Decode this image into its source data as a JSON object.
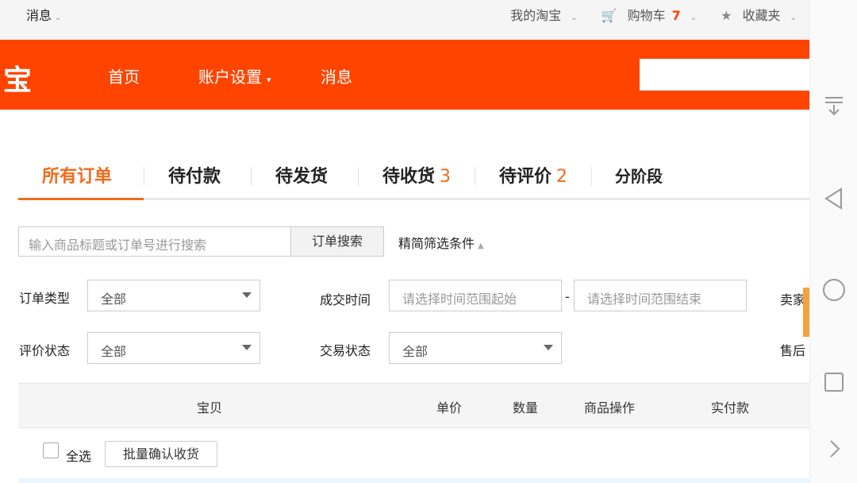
{
  "topbar": {
    "messages": "消息",
    "my_taobao": "我的淘宝",
    "cart": "购物车",
    "cart_count": "7",
    "favorites": "收藏夹"
  },
  "nav": {
    "logo": "宝",
    "home": "首页",
    "account": "账户设置",
    "messages": "消息"
  },
  "tabs": [
    {
      "label": "所有订单"
    },
    {
      "label": "待付款"
    },
    {
      "label": "待发货"
    },
    {
      "label": "待收货",
      "count": "3"
    },
    {
      "label": "待评价",
      "count": "2"
    },
    {
      "label": "分阶段"
    }
  ],
  "search": {
    "placeholder": "输入商品标题或订单号进行搜索",
    "button": "订单搜索",
    "advanced": "精简筛选条件"
  },
  "filters": {
    "order_type": {
      "label": "订单类型",
      "value": "全部"
    },
    "deal_time": {
      "label": "成交时间",
      "start_placeholder": "请选择时间范围起始",
      "end_placeholder": "请选择时间范围结束",
      "dash": "-"
    },
    "seller": {
      "label": "卖家"
    },
    "review_status": {
      "label": "评价状态",
      "value": "全部"
    },
    "trade_status": {
      "label": "交易状态",
      "value": "全部"
    },
    "after_sale": {
      "label": "售后"
    }
  },
  "table": {
    "headers": [
      "宝贝",
      "单价",
      "数量",
      "商品操作",
      "实付款"
    ]
  },
  "bulk": {
    "select_all": "全选",
    "confirm_receipt": "批量确认收货"
  }
}
